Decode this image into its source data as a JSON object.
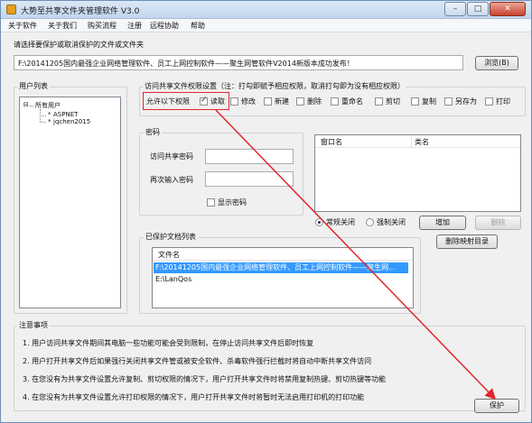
{
  "window": {
    "title": "大势至共享文件夹管理软件 V3.0",
    "controls": {
      "minimize": "–",
      "maximize": "□",
      "close": "✕"
    }
  },
  "menu": [
    "关于软件",
    "关于我们",
    "购买流程",
    "注册",
    "远程协助",
    "帮助"
  ],
  "path_section": {
    "label": "请选择要保护或取消保护的文件或文件夹",
    "value": "F:\\20141205国内最强企业网络管理软件、员工上网控制软件——聚生网管软件V2014新版本成功发布！",
    "browse_button": "浏览(B)"
  },
  "users": {
    "group_title": "用户列表",
    "root": "所有用户",
    "root_expander": "⊟",
    "children": [
      "ASPNET",
      "jqchen2015"
    ],
    "child_prefix": "*"
  },
  "permissions": {
    "group_title": "访问共享文件权限设置（注：打勾即赋予相应权限，取消打勾即为没有相应权限）",
    "allow_label": "允许以下权限",
    "items": [
      {
        "label": "读取",
        "checked": true
      },
      {
        "label": "修改",
        "checked": false
      },
      {
        "label": "新建",
        "checked": false
      },
      {
        "label": "删除",
        "checked": false
      },
      {
        "label": "重命名",
        "checked": false
      },
      {
        "label": "剪切",
        "checked": false
      },
      {
        "label": "复制",
        "checked": false
      },
      {
        "label": "另存为",
        "checked": false
      },
      {
        "label": "打印",
        "checked": false
      }
    ]
  },
  "password": {
    "group_title": "密码",
    "access_label": "访问共享密码",
    "confirm_label": "再次输入密码",
    "show_label": "显示密码"
  },
  "windows_list": {
    "col_window": "窗口名",
    "col_class": "类名",
    "radio_normal": "常规关闭",
    "radio_force": "强制关闭",
    "add_button": "增加",
    "delete_button": "删除",
    "clear_button": "删除映射目录"
  },
  "protected": {
    "group_title": "已保护文档列表",
    "col_file": "文件名",
    "files": [
      "F:\\20141205国内最强企业网络管理软件、员工上网控制软件——聚生网...",
      "E:\\LanQos"
    ]
  },
  "notes": {
    "group_title": "注意事项",
    "items": [
      "1. 用户访问共享文件期间其电脑一些功能可能会受到限制，在停止访问共享文件后即时恢复",
      "2. 用户打开共享文件后如果强行关闭共享文件管或被安全软件、杀毒软件强行拦截时将自动中断共享文件访问",
      "3. 在您没有为共享文件设置允许复制、剪切权限的情况下，用户打开共享文件时将禁用复制热键、剪切热键等功能",
      "4. 在您没有为共享文件设置允许打印权限的情况下，用户打开共享文件时将暂时无法启用打印机的打印功能"
    ]
  },
  "protect_button": "保护",
  "colors": {
    "annotation": "#e0262c",
    "selection": "#3399ff"
  }
}
